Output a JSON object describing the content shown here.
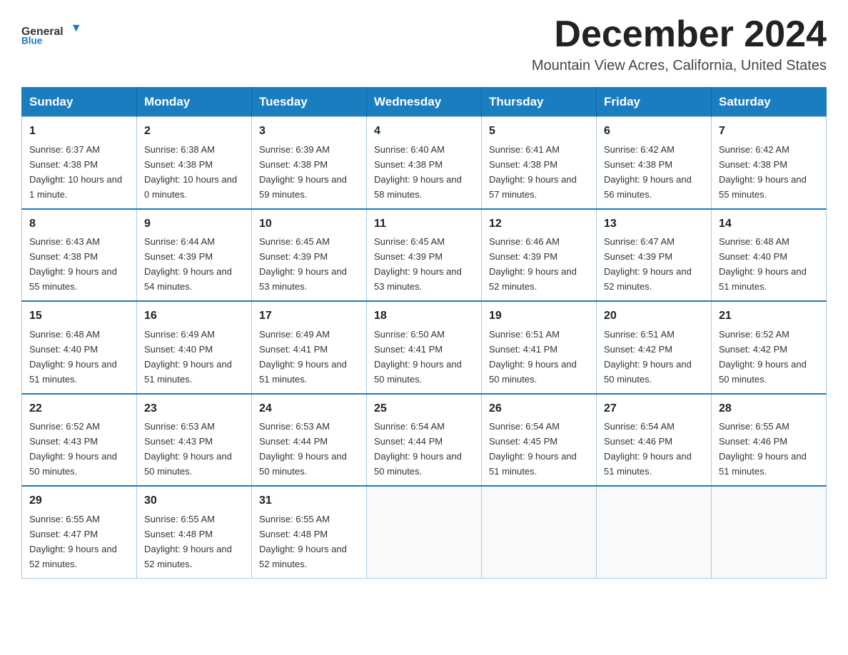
{
  "logo": {
    "text_general": "General",
    "text_blue": "Blue"
  },
  "title": "December 2024",
  "subtitle": "Mountain View Acres, California, United States",
  "days_of_week": [
    "Sunday",
    "Monday",
    "Tuesday",
    "Wednesday",
    "Thursday",
    "Friday",
    "Saturday"
  ],
  "weeks": [
    [
      {
        "day": "1",
        "sunrise": "6:37 AM",
        "sunset": "4:38 PM",
        "daylight": "10 hours and 1 minute."
      },
      {
        "day": "2",
        "sunrise": "6:38 AM",
        "sunset": "4:38 PM",
        "daylight": "10 hours and 0 minutes."
      },
      {
        "day": "3",
        "sunrise": "6:39 AM",
        "sunset": "4:38 PM",
        "daylight": "9 hours and 59 minutes."
      },
      {
        "day": "4",
        "sunrise": "6:40 AM",
        "sunset": "4:38 PM",
        "daylight": "9 hours and 58 minutes."
      },
      {
        "day": "5",
        "sunrise": "6:41 AM",
        "sunset": "4:38 PM",
        "daylight": "9 hours and 57 minutes."
      },
      {
        "day": "6",
        "sunrise": "6:42 AM",
        "sunset": "4:38 PM",
        "daylight": "9 hours and 56 minutes."
      },
      {
        "day": "7",
        "sunrise": "6:42 AM",
        "sunset": "4:38 PM",
        "daylight": "9 hours and 55 minutes."
      }
    ],
    [
      {
        "day": "8",
        "sunrise": "6:43 AM",
        "sunset": "4:38 PM",
        "daylight": "9 hours and 55 minutes."
      },
      {
        "day": "9",
        "sunrise": "6:44 AM",
        "sunset": "4:39 PM",
        "daylight": "9 hours and 54 minutes."
      },
      {
        "day": "10",
        "sunrise": "6:45 AM",
        "sunset": "4:39 PM",
        "daylight": "9 hours and 53 minutes."
      },
      {
        "day": "11",
        "sunrise": "6:45 AM",
        "sunset": "4:39 PM",
        "daylight": "9 hours and 53 minutes."
      },
      {
        "day": "12",
        "sunrise": "6:46 AM",
        "sunset": "4:39 PM",
        "daylight": "9 hours and 52 minutes."
      },
      {
        "day": "13",
        "sunrise": "6:47 AM",
        "sunset": "4:39 PM",
        "daylight": "9 hours and 52 minutes."
      },
      {
        "day": "14",
        "sunrise": "6:48 AM",
        "sunset": "4:40 PM",
        "daylight": "9 hours and 51 minutes."
      }
    ],
    [
      {
        "day": "15",
        "sunrise": "6:48 AM",
        "sunset": "4:40 PM",
        "daylight": "9 hours and 51 minutes."
      },
      {
        "day": "16",
        "sunrise": "6:49 AM",
        "sunset": "4:40 PM",
        "daylight": "9 hours and 51 minutes."
      },
      {
        "day": "17",
        "sunrise": "6:49 AM",
        "sunset": "4:41 PM",
        "daylight": "9 hours and 51 minutes."
      },
      {
        "day": "18",
        "sunrise": "6:50 AM",
        "sunset": "4:41 PM",
        "daylight": "9 hours and 50 minutes."
      },
      {
        "day": "19",
        "sunrise": "6:51 AM",
        "sunset": "4:41 PM",
        "daylight": "9 hours and 50 minutes."
      },
      {
        "day": "20",
        "sunrise": "6:51 AM",
        "sunset": "4:42 PM",
        "daylight": "9 hours and 50 minutes."
      },
      {
        "day": "21",
        "sunrise": "6:52 AM",
        "sunset": "4:42 PM",
        "daylight": "9 hours and 50 minutes."
      }
    ],
    [
      {
        "day": "22",
        "sunrise": "6:52 AM",
        "sunset": "4:43 PM",
        "daylight": "9 hours and 50 minutes."
      },
      {
        "day": "23",
        "sunrise": "6:53 AM",
        "sunset": "4:43 PM",
        "daylight": "9 hours and 50 minutes."
      },
      {
        "day": "24",
        "sunrise": "6:53 AM",
        "sunset": "4:44 PM",
        "daylight": "9 hours and 50 minutes."
      },
      {
        "day": "25",
        "sunrise": "6:54 AM",
        "sunset": "4:44 PM",
        "daylight": "9 hours and 50 minutes."
      },
      {
        "day": "26",
        "sunrise": "6:54 AM",
        "sunset": "4:45 PM",
        "daylight": "9 hours and 51 minutes."
      },
      {
        "day": "27",
        "sunrise": "6:54 AM",
        "sunset": "4:46 PM",
        "daylight": "9 hours and 51 minutes."
      },
      {
        "day": "28",
        "sunrise": "6:55 AM",
        "sunset": "4:46 PM",
        "daylight": "9 hours and 51 minutes."
      }
    ],
    [
      {
        "day": "29",
        "sunrise": "6:55 AM",
        "sunset": "4:47 PM",
        "daylight": "9 hours and 52 minutes."
      },
      {
        "day": "30",
        "sunrise": "6:55 AM",
        "sunset": "4:48 PM",
        "daylight": "9 hours and 52 minutes."
      },
      {
        "day": "31",
        "sunrise": "6:55 AM",
        "sunset": "4:48 PM",
        "daylight": "9 hours and 52 minutes."
      },
      null,
      null,
      null,
      null
    ]
  ],
  "labels": {
    "sunrise": "Sunrise:",
    "sunset": "Sunset:",
    "daylight": "Daylight:"
  }
}
